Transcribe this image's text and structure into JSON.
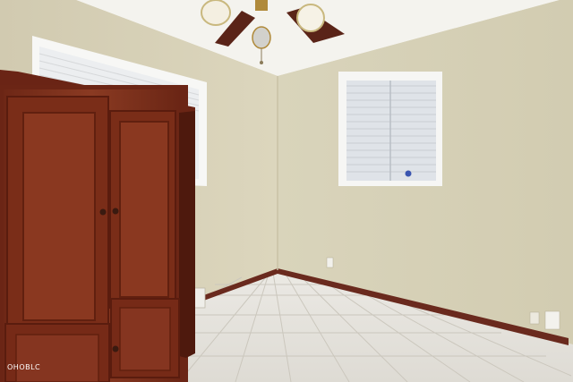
{
  "scene": {
    "description_free": true,
    "watermark": "OHOBLC",
    "colors": {
      "wall_left": "#d8d1b6",
      "wall_right": "#d7d2b7",
      "ceiling": "#f4f3ee",
      "floor_tile": "#e4e2dc",
      "grout": "#c9c6bd",
      "baseboard": "#6a2a1e",
      "cabinet": "#7a2e1c",
      "cabinet_dark": "#5b1f12",
      "window_frame": "#f7f7f5",
      "blind": "#eef0f2"
    }
  }
}
